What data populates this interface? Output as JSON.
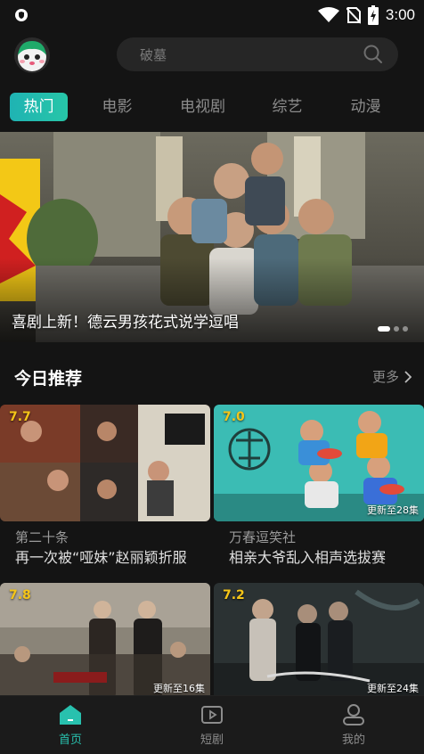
{
  "status_bar": {
    "time": "3:00"
  },
  "search": {
    "placeholder": "破墓"
  },
  "tabs": [
    {
      "label": "热门",
      "active": true
    },
    {
      "label": "电影",
      "active": false
    },
    {
      "label": "电视剧",
      "active": false
    },
    {
      "label": "综艺",
      "active": false
    },
    {
      "label": "动漫",
      "active": false
    }
  ],
  "banner": {
    "caption": "喜剧上新！德云男孩花式说学逗唱"
  },
  "section": {
    "title": "今日推荐",
    "more_label": "更多"
  },
  "cards": [
    {
      "score": "7.7",
      "update": "",
      "title": "第二十条",
      "desc": "再一次被“哑妹”赵丽颖折服"
    },
    {
      "score": "7.0",
      "update": "更新至28集",
      "title": "万春逗笑社",
      "desc": "相亲大爷乱入相声选拔赛"
    },
    {
      "score": "7.8",
      "update": "更新至16集",
      "title": "",
      "desc": ""
    },
    {
      "score": "7.2",
      "update": "更新至24集",
      "title": "",
      "desc": ""
    }
  ],
  "bottom_nav": [
    {
      "label": "首页",
      "icon": "home-icon",
      "active": true
    },
    {
      "label": "短剧",
      "icon": "video-icon",
      "active": false
    },
    {
      "label": "我的",
      "icon": "profile-icon",
      "active": false
    }
  ],
  "colors": {
    "accent": "#28c1ae",
    "score": "#f5c518",
    "background": "#141414"
  }
}
